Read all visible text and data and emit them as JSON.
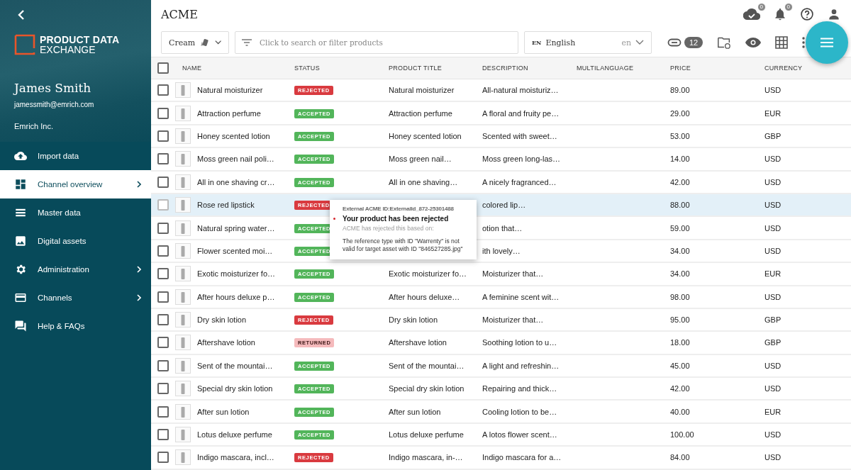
{
  "sidebar": {
    "brand": {
      "line_1": "PRODUCT DATA",
      "line_2": "EXCHANGE"
    },
    "user": {
      "name": "James Smith",
      "email": "jamessmith@emrich.com",
      "company": "Emrich Inc."
    },
    "items": [
      {
        "label": "Import data",
        "selected": false,
        "submenu": false
      },
      {
        "label": "Channel overview",
        "selected": true,
        "submenu": true
      },
      {
        "label": "Master data",
        "selected": false,
        "submenu": false
      },
      {
        "label": "Digital assets",
        "selected": false,
        "submenu": false
      },
      {
        "label": "Administration",
        "selected": false,
        "submenu": true
      },
      {
        "label": "Channels",
        "selected": false,
        "submenu": true
      },
      {
        "label": "Help & FAQs",
        "selected": false,
        "submenu": false
      }
    ]
  },
  "header": {
    "title": "ACME",
    "cloud_badge": "0",
    "bell_badge": "0"
  },
  "toolbar": {
    "swatch": "Cream",
    "search": {
      "placeholder": "Click to search or filter products"
    },
    "language": {
      "flag": "EN",
      "name": "English",
      "code": "en"
    },
    "count": "12"
  },
  "table": {
    "header_checked": false,
    "columns": [
      "NAME",
      "STATUS",
      "PRODUCT TITLE",
      "DESCRIPTION",
      "MULTILANGUAGE",
      "PRICE",
      "CURRENCY"
    ],
    "rows": [
      {
        "checked": false,
        "selected": false,
        "name": "Natural moisturizer",
        "status": "REJECTED",
        "kind": "rejected",
        "title": "Natural moisturizer",
        "description": "All-natural moisturiz…",
        "price": "89.00",
        "currency": "USD"
      },
      {
        "checked": false,
        "selected": false,
        "name": "Attraction perfume",
        "status": "ACCEPTED",
        "kind": "accepted",
        "title": "Attraction perfume",
        "description": "A floral and fruity pe…",
        "price": "29.00",
        "currency": "EUR"
      },
      {
        "checked": false,
        "selected": false,
        "name": "Honey scented lotion",
        "status": "ACCEPTED",
        "kind": "accepted",
        "title": "Honey scented lotion",
        "description": "Scented with sweet…",
        "price": "53.00",
        "currency": "GBP"
      },
      {
        "checked": false,
        "selected": false,
        "name": "Moss green nail poli…",
        "status": "ACCEPTED",
        "kind": "accepted",
        "title": "Moss green nail…",
        "description": "Moss green long-las…",
        "price": "14.00",
        "currency": "USD"
      },
      {
        "checked": false,
        "selected": false,
        "name": "All in one shaving cr…",
        "status": "ACCEPTED",
        "kind": "accepted",
        "title": "All in one shaving…",
        "description": "A nicely fragranced…",
        "price": "42.00",
        "currency": "USD"
      },
      {
        "checked": false,
        "selected": true,
        "name": "Rose red lipstick",
        "status": "REJECTED",
        "kind": "rejected",
        "description": "colored lip…",
        "price": "88.00",
        "currency": "USD"
      },
      {
        "checked": false,
        "selected": false,
        "name": "Natural spring water…",
        "status": "ACCEPTED",
        "kind": "accepted",
        "description": "otion that…",
        "price": "59.00",
        "currency": "USD"
      },
      {
        "checked": false,
        "selected": false,
        "name": "Flower scented moi…",
        "status": "ACCEPTED",
        "kind": "accepted",
        "description": "ith lovely…",
        "price": "34.00",
        "currency": "USD"
      },
      {
        "checked": false,
        "selected": false,
        "name": "Exotic moisturizer fo…",
        "status": "ACCEPTED",
        "kind": "accepted",
        "title": "Exotic moisturizer fo…",
        "description": "Moisturizer that…",
        "price": "34.00",
        "currency": "EUR"
      },
      {
        "checked": false,
        "selected": false,
        "name": "After hours deluxe p…",
        "status": "ACCEPTED",
        "kind": "accepted",
        "title": "After hours deluxe…",
        "description": "A feminine scent wit…",
        "price": "98.00",
        "currency": "USD"
      },
      {
        "checked": false,
        "selected": false,
        "name": "Dry skin lotion",
        "status": "REJECTED",
        "kind": "rejected",
        "title": "Dry skin lotion",
        "description": "Moisturizer that…",
        "price": "95.00",
        "currency": "GBP"
      },
      {
        "checked": false,
        "selected": false,
        "name": "Aftershave lotion",
        "status": "RETURNED",
        "kind": "returned",
        "title": "Aftershave lotion",
        "description": "Soothing lotion to u…",
        "price": "18.00",
        "currency": "GBP"
      },
      {
        "checked": false,
        "selected": false,
        "name": "Sent of the mountai…",
        "status": "ACCEPTED",
        "kind": "accepted",
        "title": "Sent of the mountai…",
        "description": "A light and refreshin…",
        "price": "45.00",
        "currency": "USD"
      },
      {
        "checked": false,
        "selected": false,
        "name": "Special dry skin lotion",
        "status": "ACCEPTED",
        "kind": "accepted",
        "title": "Special dry skin lotion",
        "description": "Repairing and thick…",
        "price": "42.00",
        "currency": "USD"
      },
      {
        "checked": false,
        "selected": false,
        "name": "After sun lotion",
        "status": "ACCEPTED",
        "kind": "accepted",
        "title": "After sun lotion",
        "description": "Cooling lotion to be…",
        "price": "40.00",
        "currency": "EUR"
      },
      {
        "checked": false,
        "selected": false,
        "name": "Lotus deluxe perfume",
        "status": "ACCEPTED",
        "kind": "accepted",
        "title": "Lotus deluxe perfume",
        "description": "A lotos flower scent…",
        "price": "100.00",
        "currency": "USD"
      },
      {
        "checked": false,
        "selected": false,
        "name": "Indigo mascara, incl…",
        "status": "REJECTED",
        "kind": "rejected",
        "title": "Indigo mascara, in-…",
        "description": "Indigo mascara for a…",
        "price": "84.00",
        "currency": "USD"
      }
    ]
  },
  "tooltip": {
    "id_line": "External ACME ID:ExternalId_872-25301488",
    "heading": "Your product has been rejected",
    "subheading": "ACME has rejected this based on:",
    "message": "The reference type with ID \"Warrenty\" is not valid for target asset with ID \"846527285.jpg\""
  }
}
